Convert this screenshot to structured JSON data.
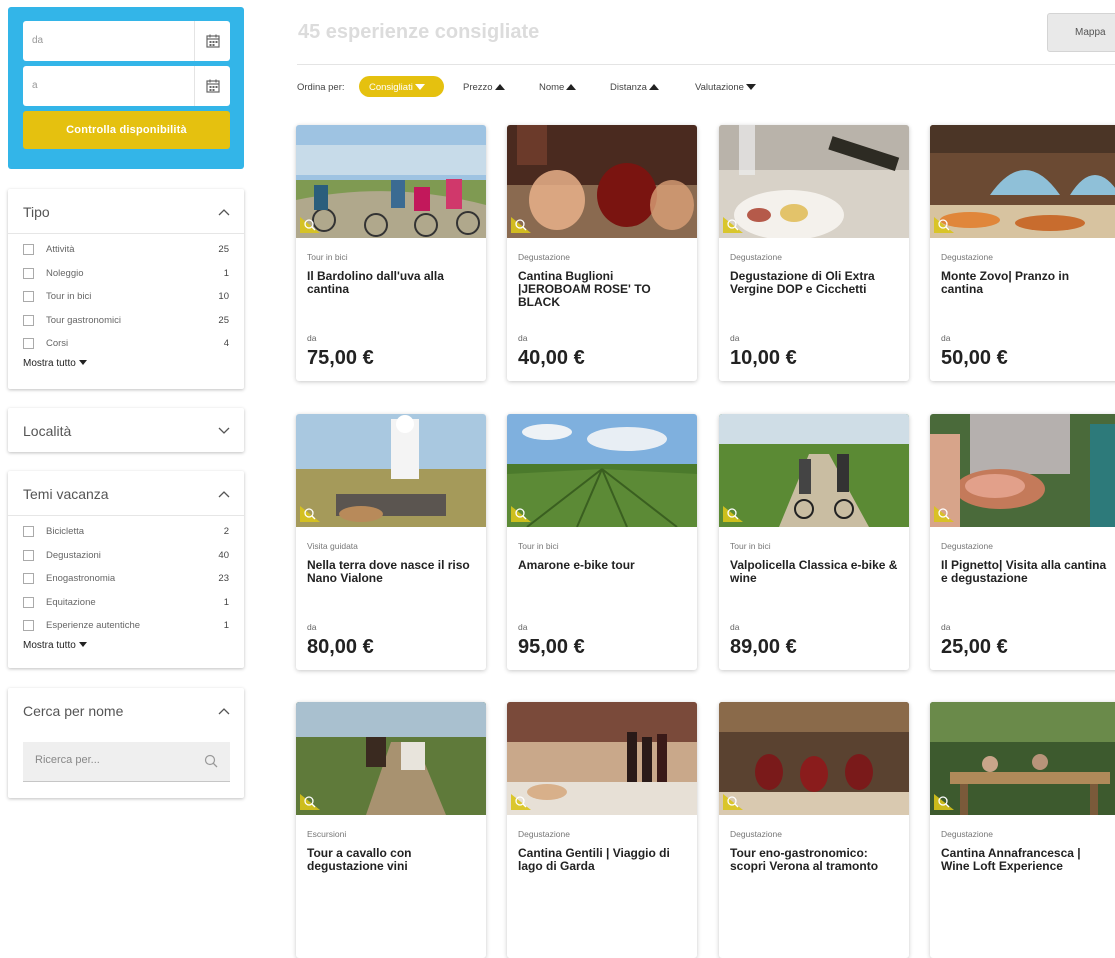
{
  "availability": {
    "from_placeholder": "da",
    "to_placeholder": "a",
    "check_button": "Controlla disponibilità",
    "calendar_icon": "calendar-icon"
  },
  "filters": {
    "tipo": {
      "title": "Tipo",
      "items": [
        {
          "label": "Attività",
          "count": "25"
        },
        {
          "label": "Noleggio",
          "count": "1"
        },
        {
          "label": "Tour in bici",
          "count": "10"
        },
        {
          "label": "Tour gastronomici",
          "count": "25"
        },
        {
          "label": "Corsi",
          "count": "4"
        }
      ],
      "show_all": "Mostra tutto"
    },
    "localita": {
      "title": "Località"
    },
    "temi": {
      "title": "Temi vacanza",
      "items": [
        {
          "label": "Bicicletta",
          "count": "2"
        },
        {
          "label": "Degustazioni",
          "count": "40"
        },
        {
          "label": "Enogastronomia",
          "count": "23"
        },
        {
          "label": "Equitazione",
          "count": "1"
        },
        {
          "label": "Esperienze autentiche",
          "count": "1"
        }
      ],
      "show_all": "Mostra tutto"
    },
    "search_name": {
      "title": "Cerca per nome",
      "placeholder": "Ricerca per..."
    }
  },
  "main": {
    "title": "45 esperienze consigliate",
    "map_button": "Mappa",
    "sort_label": "Ordina per:",
    "sort_options": [
      "Consigliati",
      "Prezzo",
      "Nome",
      "Distanza",
      "Valutazione"
    ]
  },
  "accent_color": "#e5c10f",
  "availability_color": "#33b5e8",
  "cards": [
    {
      "category": "Tour in bici",
      "name": "Il Bardolino dall'uva alla cantina",
      "from": "da",
      "price": "75,00 €"
    },
    {
      "category": "Degustazione",
      "name": "Cantina Buglioni |JEROBOAM ROSE' TO BLACK",
      "from": "da",
      "price": "40,00 €"
    },
    {
      "category": "Degustazione",
      "name": "Degustazione di Oli Extra Vergine DOP e Cicchetti",
      "from": "da",
      "price": "10,00 €"
    },
    {
      "category": "Degustazione",
      "name": "Monte Zovo| Pranzo in cantina",
      "from": "da",
      "price": "50,00 €"
    },
    {
      "category": "Visita guidata",
      "name": "Nella terra dove nasce il riso Nano Vialone",
      "from": "da",
      "price": "80,00 €"
    },
    {
      "category": "Tour in bici",
      "name": "Amarone e-bike tour",
      "from": "da",
      "price": "95,00 €"
    },
    {
      "category": "Tour in bici",
      "name": "Valpolicella Classica e-bike & wine",
      "from": "da",
      "price": "89,00 €"
    },
    {
      "category": "Degustazione",
      "name": "Il Pignetto| Visita alla cantina e degustazione",
      "from": "da",
      "price": "25,00 €"
    },
    {
      "category": "Escursioni",
      "name": "Tour a cavallo con degustazione vini",
      "from": "",
      "price": ""
    },
    {
      "category": "Degustazione",
      "name": "Cantina Gentili | Viaggio di lago di Garda",
      "from": "",
      "price": ""
    },
    {
      "category": "Degustazione",
      "name": "Tour eno-gastronomico: scopri Verona al tramonto",
      "from": "",
      "price": ""
    },
    {
      "category": "Degustazione",
      "name": "Cantina Annafrancesca | Wine Loft Experience",
      "from": "",
      "price": ""
    }
  ]
}
